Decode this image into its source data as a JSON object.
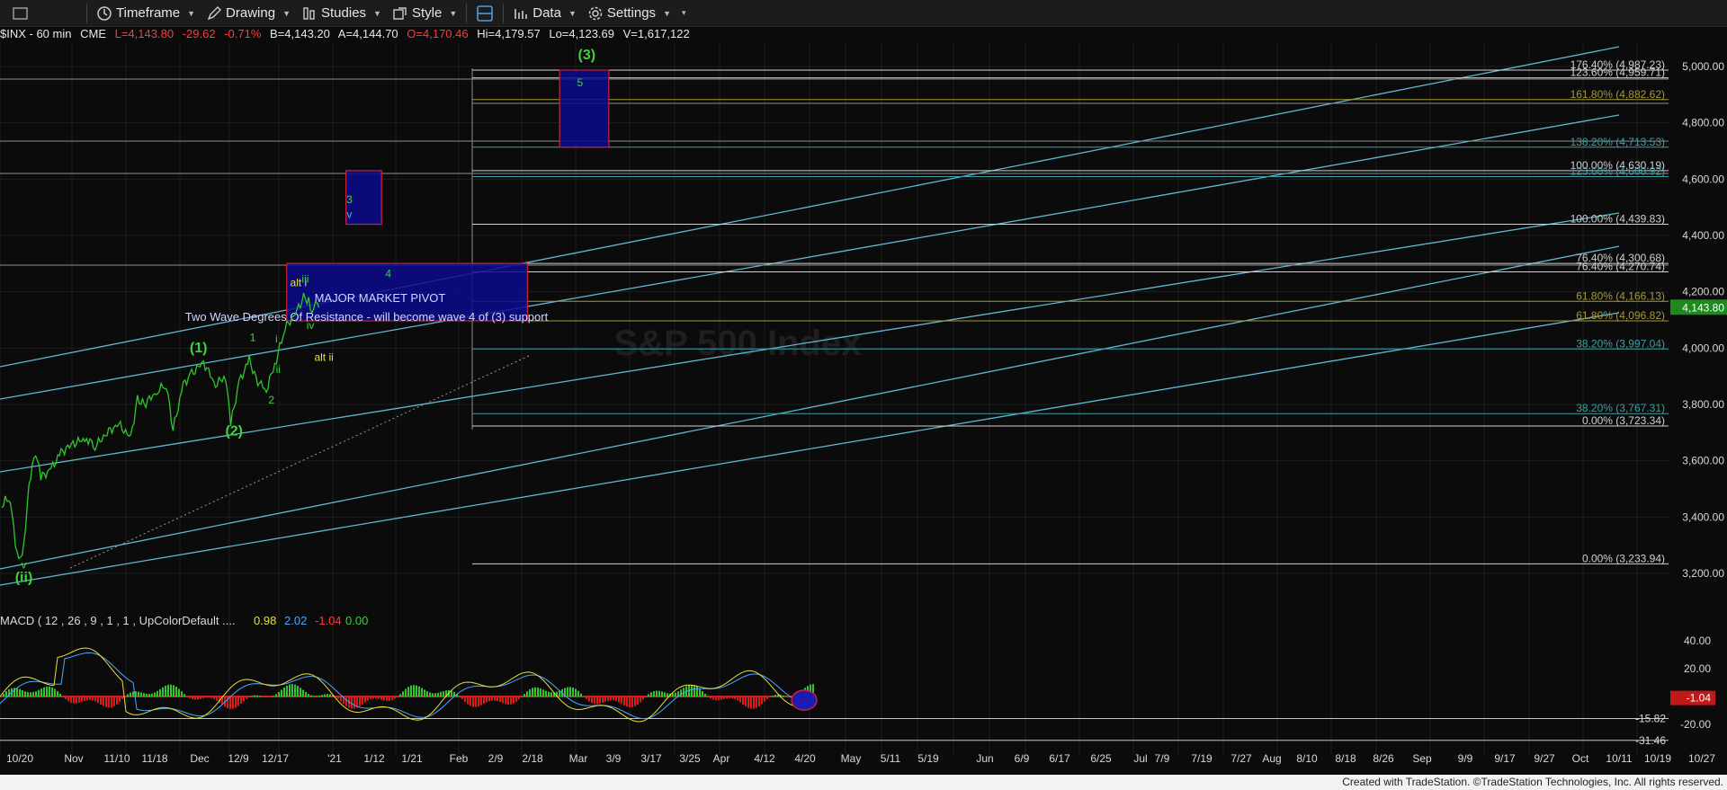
{
  "toolbar": {
    "items": [
      {
        "label": "Timeframe",
        "icon": "clock-icon"
      },
      {
        "label": "Drawing",
        "icon": "pen-icon"
      },
      {
        "label": "Studies",
        "icon": "studies-icon"
      },
      {
        "label": "Style",
        "icon": "style-icon"
      },
      {
        "label": "Data",
        "icon": "data-icon"
      },
      {
        "label": "Settings",
        "icon": "gear-icon"
      }
    ]
  },
  "info": {
    "symbol": "$INX - 60 min",
    "exchange": "CME",
    "last": "L=4,143.80",
    "change": "-29.62",
    "change_pct": "-0.71%",
    "bid": "B=4,143.20",
    "ask": "A=4,144.70",
    "open": "O=4,170.46",
    "high": "Hi=4,179.57",
    "low": "Lo=4,123.69",
    "volume": "V=1,617,122"
  },
  "macd_header": {
    "label": "MACD ( 12 , 26 , 9 , 1 , 1 , UpColorDefault ....",
    "v1": "0.98",
    "v2": "2.02",
    "v3": "-1.04",
    "v4": "0.00"
  },
  "watermark": "S&P 500 Index",
  "colors": {
    "price": "#2ec72e",
    "channel": "#5fb8d0",
    "box_fill": "#0a0a8c",
    "box_edge": "#d0203a",
    "fib_olive": "#a49a3a",
    "fib_teal": "#3aa0a8",
    "label_blue": "#5aa9e6",
    "label_green": "#3bd43b",
    "label_yellow": "#e6e03a"
  },
  "chart_data": {
    "type": "line",
    "title": "",
    "price_axis": {
      "ticks": [
        "5,000.00",
        "4,800.00",
        "4,600.00",
        "4,400.00",
        "4,200.00",
        "4,000.00",
        "3,800.00",
        "3,600.00",
        "3,400.00",
        "3,200.00"
      ],
      "ylim": [
        3110,
        5108
      ],
      "last_price_tag": "4,143.80"
    },
    "time_axis": {
      "ticks": [
        "10/20",
        "Nov",
        "11/10",
        "11/18",
        "Dec",
        "12/9",
        "12/17",
        "'21",
        "1/12",
        "1/21",
        "Feb",
        "2/9",
        "2/18",
        "Mar",
        "3/9",
        "3/17",
        "3/25",
        "Apr",
        "4/12",
        "4/20",
        "May",
        "5/11",
        "5/19",
        "Jun",
        "6/9",
        "6/17",
        "6/25",
        "Jul",
        "7/9",
        "7/19",
        "7/27",
        "Aug",
        "8/10",
        "8/18",
        "8/26",
        "Sep",
        "9/9",
        "9/17",
        "9/27",
        "Oct",
        "10/11",
        "10/19",
        "10/27"
      ]
    },
    "price_series": [
      {
        "x": "10/20/2020",
        "y": 3440
      },
      {
        "x": "10/23/2020",
        "y": 3470
      },
      {
        "x": "10/26/2020",
        "y": 3420
      },
      {
        "x": "10/28/2020",
        "y": 3290
      },
      {
        "x": "10/30/2020",
        "y": 3240
      },
      {
        "x": "11/2/2020",
        "y": 3300
      },
      {
        "x": "11/5/2020",
        "y": 3520
      },
      {
        "x": "11/9/2020",
        "y": 3630
      },
      {
        "x": "11/12/2020",
        "y": 3540
      },
      {
        "x": "11/18/2020",
        "y": 3570
      },
      {
        "x": "11/24/2020",
        "y": 3630
      },
      {
        "x": "12/1/2020",
        "y": 3660
      },
      {
        "x": "12/9/2020",
        "y": 3680
      },
      {
        "x": "12/14/2020",
        "y": 3650
      },
      {
        "x": "12/21/2020",
        "y": 3700
      },
      {
        "x": "12/28/2020",
        "y": 3730
      },
      {
        "x": "1/4/2021",
        "y": 3680
      },
      {
        "x": "1/8/2021",
        "y": 3820
      },
      {
        "x": "1/12/2021",
        "y": 3800
      },
      {
        "x": "1/20/2021",
        "y": 3850
      },
      {
        "x": "1/25/2021",
        "y": 3870
      },
      {
        "x": "1/29/2021",
        "y": 3710
      },
      {
        "x": "2/4/2021",
        "y": 3870
      },
      {
        "x": "2/9/2021",
        "y": 3910
      },
      {
        "x": "2/16/2021",
        "y": 3950
      },
      {
        "x": "2/23/2021",
        "y": 3870
      },
      {
        "x": "3/1/2021",
        "y": 3900
      },
      {
        "x": "3/4/2021",
        "y": 3730
      },
      {
        "x": "3/9/2021",
        "y": 3880
      },
      {
        "x": "3/15/2021",
        "y": 3960
      },
      {
        "x": "3/19/2021",
        "y": 3890
      },
      {
        "x": "3/25/2021",
        "y": 3850
      },
      {
        "x": "3/31/2021",
        "y": 3960
      },
      {
        "x": "4/5/2021",
        "y": 4070
      },
      {
        "x": "4/12/2021",
        "y": 4130
      },
      {
        "x": "4/16/2021",
        "y": 4180
      },
      {
        "x": "4/19/2021",
        "y": 4170
      },
      {
        "x": "4/21/2021",
        "y": 4130
      },
      {
        "x": "4/23/2021",
        "y": 4180
      },
      {
        "x": "4/25/2021",
        "y": 4144
      }
    ],
    "fib_levels": [
      {
        "label": "176.40% (4,987.23)",
        "value": 4987.23
      },
      {
        "label": "123.60% (4,959.71)",
        "value": 4959.71
      },
      {
        "label": "161.80% (4,882.62)",
        "value": 4882.62
      },
      {
        "label": "138.20% (4,713.53)",
        "value": 4713.53
      },
      {
        "label": "100.00% (4,630.19)",
        "value": 4630.19
      },
      {
        "label": "123.60% (4,608.92)",
        "value": 4608.92
      },
      {
        "label": "100.00% (4,439.83)",
        "value": 4439.83
      },
      {
        "label": "76.40% (4,300.68)",
        "value": 4300.68
      },
      {
        "label": "76.40% (4,270.74)",
        "value": 4270.74
      },
      {
        "label": "61.80% (4,166.13)",
        "value": 4166.13
      },
      {
        "label": "61.80% (4,096.82)",
        "value": 4096.82
      },
      {
        "label": "38.20% (3,997.04)",
        "value": 3997.04
      },
      {
        "label": "38.20% (3,767.31)",
        "value": 3767.31
      },
      {
        "label": "0.00% (3,723.34)",
        "value": 3723.34
      },
      {
        "label": "0.00% (3,233.94)",
        "value": 3233.94
      }
    ],
    "target_boxes": [
      {
        "from": "4/6/2021",
        "to": "8/26/2021",
        "low": 4096.82,
        "high": 4300.68,
        "text": [
          "MAJOR MARKET PIVOT",
          "Two Wave Degrees Of Resistance - will become wave 4 of (3) support"
        ]
      },
      {
        "from": "5/11/2021",
        "to": "6/1/2021",
        "low": 4439.83,
        "high": 4630.19,
        "text": []
      },
      {
        "from": "9/14/2021",
        "to": "10/13/2021",
        "low": 4713.53,
        "high": 4987.23,
        "text": []
      }
    ],
    "wave_labels": [
      {
        "text": "(3)",
        "x": "9/30/2021",
        "y": 5025,
        "color": "green"
      },
      {
        "text": "5",
        "x": "9/26/2021",
        "y": 4930,
        "color": "green"
      },
      {
        "text": "3",
        "x": "5/13/2021",
        "y": 4515,
        "color": "green"
      },
      {
        "text": "v",
        "x": "5/13/2021",
        "y": 4463,
        "color": "blue"
      },
      {
        "text": "4",
        "x": "6/5/2021",
        "y": 4252,
        "color": "green"
      },
      {
        "text": "alt i",
        "x": "4/13/2021",
        "y": 4220,
        "color": "yellow"
      },
      {
        "text": "iii",
        "x": "4/17/2021",
        "y": 4232,
        "color": "green"
      },
      {
        "text": "iv",
        "x": "4/20/2021",
        "y": 4068,
        "color": "green"
      },
      {
        "text": "alt ii",
        "x": "4/28/2021",
        "y": 3955,
        "color": "yellow"
      },
      {
        "text": "(1)",
        "x": "2/13/2021",
        "y": 3985,
        "color": "green"
      },
      {
        "text": "1",
        "x": "3/17/2021",
        "y": 4025,
        "color": "green"
      },
      {
        "text": "i",
        "x": "3/31/2021",
        "y": 4020,
        "color": "green"
      },
      {
        "text": "ii",
        "x": "4/1/2021",
        "y": 3912,
        "color": "green"
      },
      {
        "text": "2",
        "x": "3/28/2021",
        "y": 3803,
        "color": "green"
      },
      {
        "text": "(2)",
        "x": "3/6/2021",
        "y": 3690,
        "color": "green"
      },
      {
        "text": "v",
        "x": "11/2/2020",
        "y": 3218,
        "color": "green"
      },
      {
        "text": "(ii)",
        "x": "11/2/2020",
        "y": 3170,
        "color": "green"
      }
    ],
    "macd": {
      "params": [
        12,
        26,
        9,
        1,
        1
      ],
      "macd": 0.98,
      "signal": 2.02,
      "histogram": -1.04,
      "zero": 0.0,
      "ticks": [
        "40.00",
        "20.00",
        "-20.00"
      ],
      "markers": [
        "-15.82",
        "-31.46"
      ],
      "last_tag": "-1.04"
    }
  },
  "footer": "Created with TradeStation. ©TradeStation Technologies, Inc. All rights reserved."
}
